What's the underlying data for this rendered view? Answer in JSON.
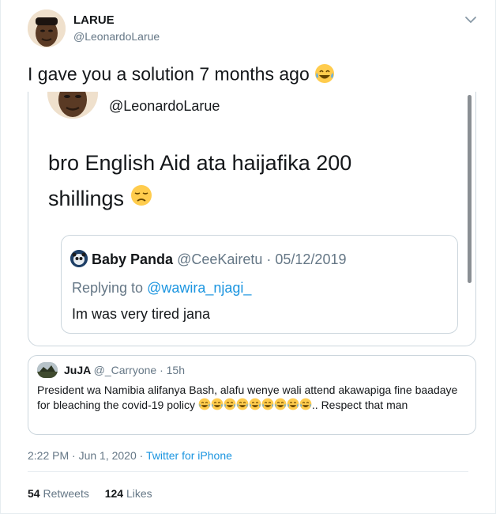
{
  "author": {
    "name": "LARUE",
    "handle": "@LeonardoLarue"
  },
  "tweet": {
    "text": "I gave you a solution 7 months ago",
    "emoji": "face-with-tears-of-joy"
  },
  "quoted_tweet": {
    "handle": "@LeonardoLarue",
    "text_line1": "bro English Aid ata haijafika 200",
    "text_line2": "shillings",
    "emoji": "disappointed-face",
    "inner_quote": {
      "name": "Baby Panda",
      "meta": "@CeeKairetu · 05/12/2019",
      "replying_label": "Replying to",
      "replying_to": "@wawira_njagi_",
      "text": "Im was very tired jana"
    }
  },
  "reply_card": {
    "name": "JuJA",
    "meta": "@_Carryone · 15h",
    "text_before": "President wa Namibia alifanya Bash, alafu wenye wali attend akawapiga fine baadaye for bleaching the covid-19 policy",
    "emoji_count": 9,
    "text_after": ".. Respect that man"
  },
  "timestamp": {
    "time": "2:22 PM · Jun 1, 2020 · ",
    "via": "Twitter for iPhone"
  },
  "stats": {
    "retweets_count": "54",
    "retweets_label": "Retweets",
    "likes_count": "124",
    "likes_label": "Likes"
  },
  "colors": {
    "link": "#1b95e0",
    "secondary_text": "#657786",
    "border": "#ccd6dd"
  }
}
